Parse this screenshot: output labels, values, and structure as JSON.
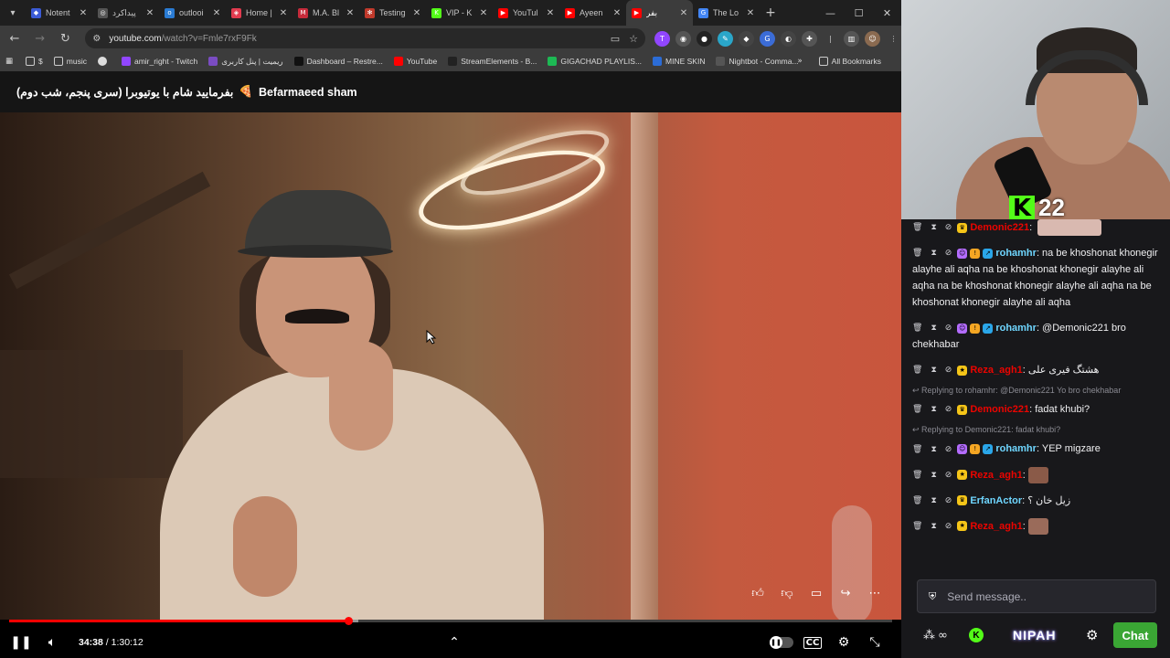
{
  "browser": {
    "tabs": [
      {
        "label": "Notent",
        "color": "#3b5bd6",
        "glyph": "◆"
      },
      {
        "label": "پیداکرد",
        "color": "#555555",
        "glyph": "◎"
      },
      {
        "label": "outlooi",
        "color": "#2a7bd3",
        "glyph": "o"
      },
      {
        "label": "Home |",
        "color": "#e23b4f",
        "glyph": "◈"
      },
      {
        "label": "M.A. Bl",
        "color": "#c62b3b",
        "glyph": "M"
      },
      {
        "label": "Testing",
        "color": "#c0392b",
        "glyph": "✻"
      },
      {
        "label": "VIP - K",
        "color": "#53fc18",
        "glyph": "K"
      },
      {
        "label": "YouTul",
        "color": "#ff0000",
        "glyph": "▶"
      },
      {
        "label": "Ayeen",
        "color": "#ff0000",
        "glyph": "▶"
      },
      {
        "label": "بفر",
        "color": "#ff0000",
        "glyph": "▶"
      },
      {
        "label": "The Lo",
        "color": "#4285f4",
        "glyph": "G"
      }
    ],
    "url": "youtube.com",
    "url_path": "/watch?v=Fmle7rxF9Fk",
    "bookmarks": [
      {
        "label": "$",
        "icon": "folder-icon"
      },
      {
        "label": "music",
        "icon": "folder-icon"
      },
      {
        "label": "",
        "icon": "globe-icon"
      },
      {
        "label": "amir_right - Twitch",
        "icon": "twitch-icon"
      },
      {
        "label": "ریمیت | پنل کاربری",
        "icon": "remit-icon"
      },
      {
        "label": "Dashboard – Restre...",
        "icon": "restream-icon"
      },
      {
        "label": "YouTube",
        "icon": "youtube-icon"
      },
      {
        "label": "StreamElements - B...",
        "icon": "streamelements-icon"
      },
      {
        "label": "GIGACHAD PLAYLIS...",
        "icon": "spotify-icon"
      },
      {
        "label": "MINE SKIN",
        "icon": "mineskin-icon"
      },
      {
        "label": "Nightbot - Comma...",
        "icon": "nightbot-icon"
      }
    ],
    "all_bookmarks": "All Bookmarks"
  },
  "video": {
    "title_en": "Befarmaeed sham",
    "title_fa": "بفرمایید شام با یوتیوبرا (سری پنجم، شب دوم)",
    "current_time": "34:38",
    "duration": "1:30:12",
    "time_sep": " / ",
    "played_fraction": 0.384,
    "buffered_fraction": 0.395
  },
  "stream": {
    "platform_letter": "K",
    "viewer_count": "22",
    "accent": "#53fc18"
  },
  "chat": {
    "messages": [
      {
        "user": "Demonic221",
        "color": "#eb0400",
        "badges": [
          "crown"
        ],
        "text": ": ",
        "emote": true
      },
      {
        "user": "rohamhr",
        "color": "#6fd6ff",
        "badges": [
          "sub",
          "gift",
          "arrow"
        ],
        "text": ": na be khoshonat khonegir alayhe ali aqha  na be khoshonat khonegir alayhe ali aqha  na be khoshonat khonegir alayhe ali aqha  na be khoshonat khonegir alayhe ali aqha "
      },
      {
        "user": "rohamhr",
        "color": "#6fd6ff",
        "badges": [
          "sub",
          "gift",
          "arrow"
        ],
        "text": ": @Demonic221 bro chekhabar"
      },
      {
        "user": "Reza_agh1",
        "color": "#eb0400",
        "badges": [
          "sub-yellow"
        ],
        "text": ": هشتگ فیری علی"
      },
      {
        "reply": "Replying to rohamhr: @Demonic221 Yo bro chekhabar"
      },
      {
        "user": "Demonic221",
        "color": "#eb0400",
        "badges": [
          "crown"
        ],
        "text": ": fadat khubi?"
      },
      {
        "reply": "Replying to Demonic221: fadat khubi?"
      },
      {
        "user": "rohamhr",
        "color": "#6fd6ff",
        "badges": [
          "sub",
          "gift",
          "arrow"
        ],
        "text": ": YEP migzare"
      },
      {
        "user": "Reza_agh1",
        "color": "#eb0400",
        "badges": [
          "sub-yellow"
        ],
        "text": ":",
        "emote": true
      },
      {
        "user": "ErfanActor",
        "color": "#6fd6ff",
        "badges": [
          "crown"
        ],
        "text": ": زیل خان ؟"
      },
      {
        "user": "Reza_agh1",
        "color": "#eb0400",
        "badges": [
          "sub-yellow"
        ],
        "text": ":",
        "emote": true
      }
    ],
    "input_placeholder": "Send message..",
    "brand": "NIPAH",
    "send_label": "Chat"
  }
}
